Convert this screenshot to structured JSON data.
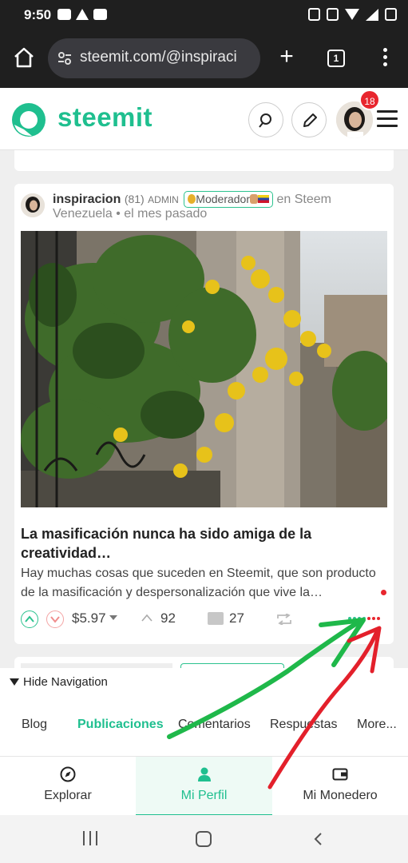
{
  "status_bar": {
    "time": "9:50"
  },
  "browser": {
    "url": "steemit.com/@inspiraci",
    "tab_count": "1",
    "plus_label": "+"
  },
  "header": {
    "brand": "steemit",
    "notification_count": "18"
  },
  "post": {
    "author": "inspiracion",
    "reputation": "(81)",
    "role": "ADMIN",
    "badge_text": "Moderador",
    "community_prefix": "en Steem",
    "community_rest": "Venezuela",
    "time_ago": "el mes pasado",
    "title": "La masificación nunca ha sido amiga de la creatividad…",
    "summary": "Hay muchas cosas que suceden en Steemit, que son producto de la masificación y despersonalización que vive la…",
    "payout": "$5.97",
    "votes": "92",
    "comments": "27",
    "vote_dots": [
      "#2cc28f",
      "#2cc28f",
      "#2cc28f",
      "#2cc28f",
      "#e8262e",
      "#e8262e",
      "#e8262e"
    ]
  },
  "profile_nav": {
    "toggle_label": "Hide Navigation",
    "tabs": [
      {
        "label": "Blog",
        "active": false
      },
      {
        "label": "Publicaciones",
        "active": true
      },
      {
        "label": "Comentarios",
        "active": false
      },
      {
        "label": "Respuestas",
        "active": false
      },
      {
        "label": "More...",
        "active": false
      }
    ]
  },
  "bottom_tabs": [
    {
      "label": "Explorar",
      "icon": "compass-icon",
      "active": false
    },
    {
      "label": "Mi Perfil",
      "icon": "person-icon",
      "active": true
    },
    {
      "label": "Mi Monedero",
      "icon": "wallet-icon",
      "active": false
    }
  ],
  "colors": {
    "accent": "#1fbf8f",
    "annotation_green": "#1fb84a",
    "annotation_red": "#e3202b"
  }
}
